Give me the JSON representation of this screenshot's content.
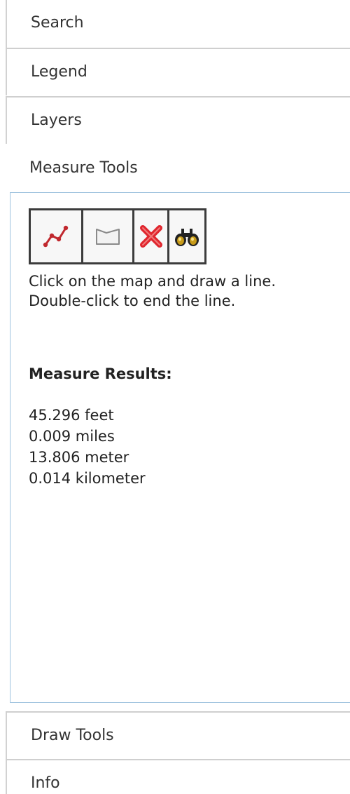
{
  "accordion": {
    "sections": {
      "search": "Search",
      "legend": "Legend",
      "layers": "Layers",
      "measure": "Measure Tools",
      "draw": "Draw Tools",
      "info": "Info"
    }
  },
  "measure": {
    "tools": [
      {
        "icon": "measure-line-icon",
        "color": "#c0282e"
      },
      {
        "icon": "measure-area-icon",
        "color": "#8a8a8a"
      },
      {
        "icon": "clear-icon",
        "color": "#e0262e"
      },
      {
        "icon": "binoculars-icon",
        "color": "#c89b18"
      }
    ],
    "instructions": "Click on the map and draw a line. Double-click to end the line.",
    "results_title": "Measure Results:",
    "results": [
      "45.296 feet",
      "0.009 miles",
      "13.806 meter",
      "0.014 kilometer"
    ]
  },
  "colors": {
    "panel_border": "#9fc3de",
    "divider": "#cfcfcf",
    "toolbar_border": "#3c3c3c"
  }
}
